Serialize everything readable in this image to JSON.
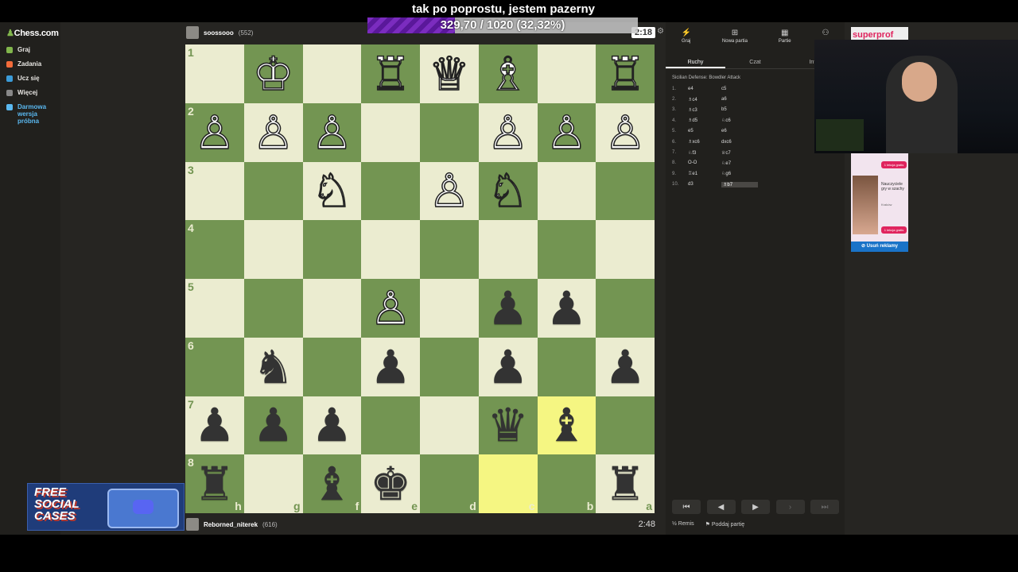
{
  "overlay": {
    "caption": "tak po poprostu, jestem pazerny",
    "goal_text": "329,70 / 1020 (32,32%)",
    "goal_fraction": 0.3232,
    "promo_text": "FREE SOCIAL CASES"
  },
  "nav": {
    "logo": "Chess.com",
    "items": [
      "Graj",
      "Zadania",
      "Ucz się",
      "Więcej"
    ],
    "trial": "Darmowa wersja próbna"
  },
  "top_player": {
    "name": "soossooo",
    "rating": "(552)",
    "clock": "2:18"
  },
  "bottom_player": {
    "name": "Reborned_niterek",
    "rating": "(616)",
    "clock": "2:48"
  },
  "board": {
    "rank_labels": [
      "1",
      "2",
      "3",
      "4",
      "5",
      "6",
      "7",
      "8"
    ],
    "file_labels": [
      "h",
      "g",
      "f",
      "e",
      "d",
      "c",
      "b",
      "a"
    ],
    "rows": [
      [
        "",
        "wK",
        "",
        "wR",
        "wQ",
        "wB",
        "",
        "wR"
      ],
      [
        "wP",
        "wP",
        "wP",
        "",
        "",
        "wP",
        "wP",
        "wP"
      ],
      [
        "",
        "",
        "wN",
        "",
        "wP",
        "wN",
        "",
        ""
      ],
      [
        "",
        "",
        "",
        "",
        "",
        "",
        "",
        ""
      ],
      [
        "",
        "",
        "",
        "wP",
        "",
        "bP",
        "bP",
        ""
      ],
      [
        "",
        "bN",
        "",
        "bP",
        "",
        "bP",
        "",
        "bP"
      ],
      [
        "bP",
        "bP",
        "bP",
        "",
        "",
        "bQ",
        "bB",
        ""
      ],
      [
        "bR",
        "",
        "bB",
        "bK",
        "",
        "",
        "",
        "bR"
      ]
    ],
    "highlights": [
      "6,6",
      "7,5"
    ]
  },
  "right_panel": {
    "tabs": [
      "Graj",
      "Nowa partia",
      "Partie"
    ],
    "subtabs": [
      "Ruchy",
      "Czat",
      "Infor"
    ],
    "opening": "Sicilian Defense: Bowdler Attack",
    "moves": [
      {
        "n": "1.",
        "w": "e4",
        "b": "c5"
      },
      {
        "n": "2.",
        "w": "♗c4",
        "b": "a6"
      },
      {
        "n": "3.",
        "w": "♗c3",
        "b": "b5"
      },
      {
        "n": "4.",
        "w": "♗d5",
        "b": "♘c6"
      },
      {
        "n": "5.",
        "w": "e5",
        "b": "e6"
      },
      {
        "n": "6.",
        "w": "♗xc6",
        "b": "dxc6"
      },
      {
        "n": "7.",
        "w": "♘f3",
        "b": "♕c7"
      },
      {
        "n": "8.",
        "w": "O-O",
        "b": "♘e7"
      },
      {
        "n": "9.",
        "w": "♖e1",
        "b": "♘g6"
      },
      {
        "n": "10.",
        "w": "d3",
        "b": "♗b7"
      }
    ],
    "footer": [
      "Remis",
      "Poddaj partię"
    ]
  },
  "ad": {
    "tag": "superprof",
    "title": "Nauczyciele gry w szachy",
    "city": "Kraków",
    "btn1": "1 lekcja gratis",
    "btn2": "1 lekcja gratis",
    "remove": "Usuń reklamy"
  }
}
